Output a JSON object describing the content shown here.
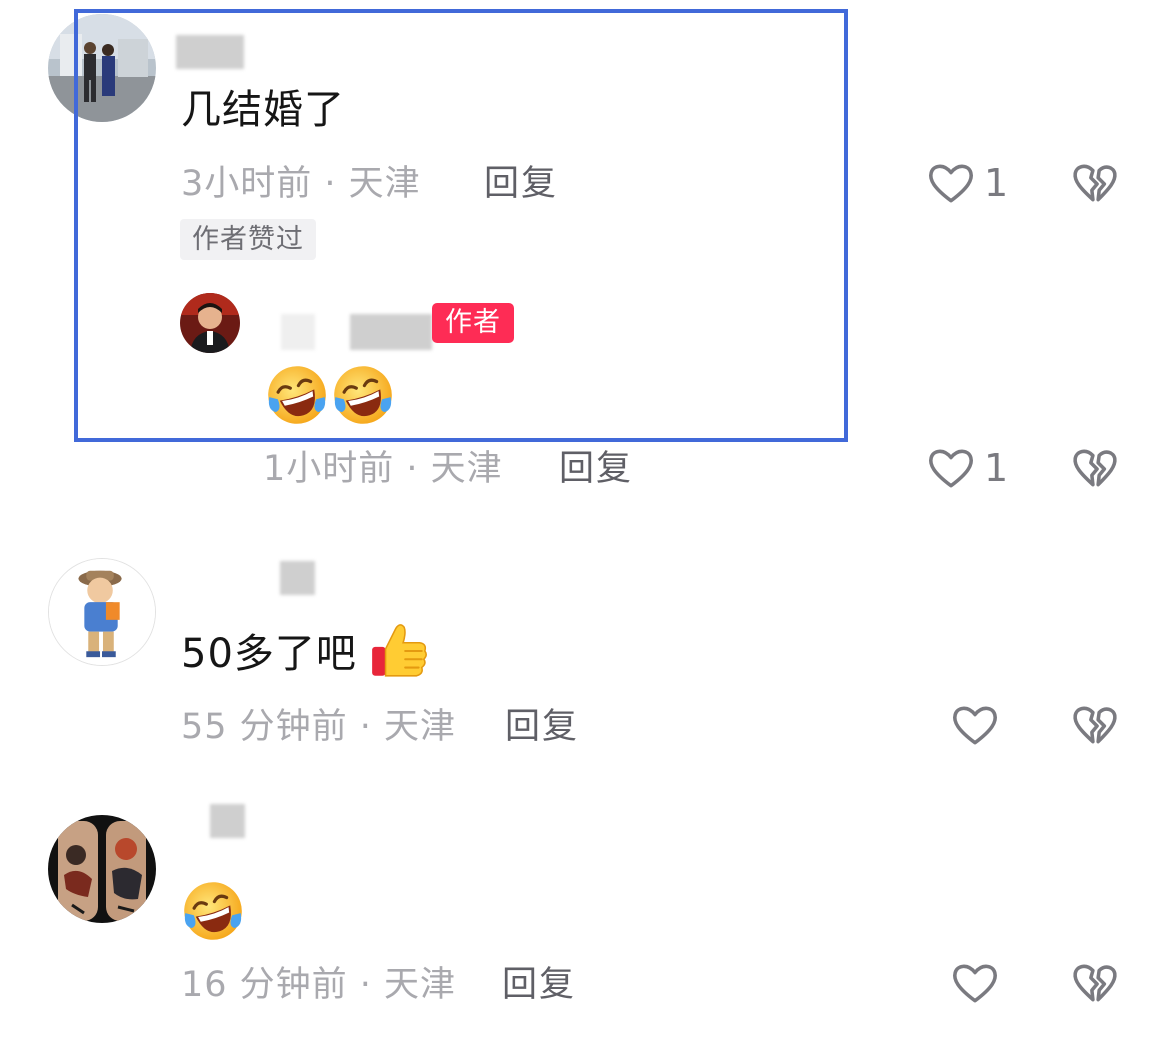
{
  "comments": [
    {
      "text": "几结婚了",
      "time_location": "3小时前 · 天津",
      "reply_label": "回复",
      "like_count": "1",
      "badge": "作者赞过"
    },
    {
      "is_reply": true,
      "author_badge": "作者",
      "time_location": "1小时前 · 天津",
      "reply_label": "回复",
      "like_count": "1"
    },
    {
      "text": "50多了吧",
      "time_location": "55 分钟前 · 天津",
      "reply_label": "回复"
    },
    {
      "time_location": "16 分钟前 · 天津",
      "reply_label": "回复"
    }
  ],
  "icons": {
    "like": "heart-outline-icon",
    "dislike": "broken-heart-icon",
    "laugh_emoji": "rolling-laugh-emoji",
    "thumbs_up_emoji": "thumbs-up-emoji"
  },
  "colors": {
    "author_badge": "#fe2c55",
    "highlight_border": "#4169d9",
    "meta_text": "#a9a9ae"
  }
}
